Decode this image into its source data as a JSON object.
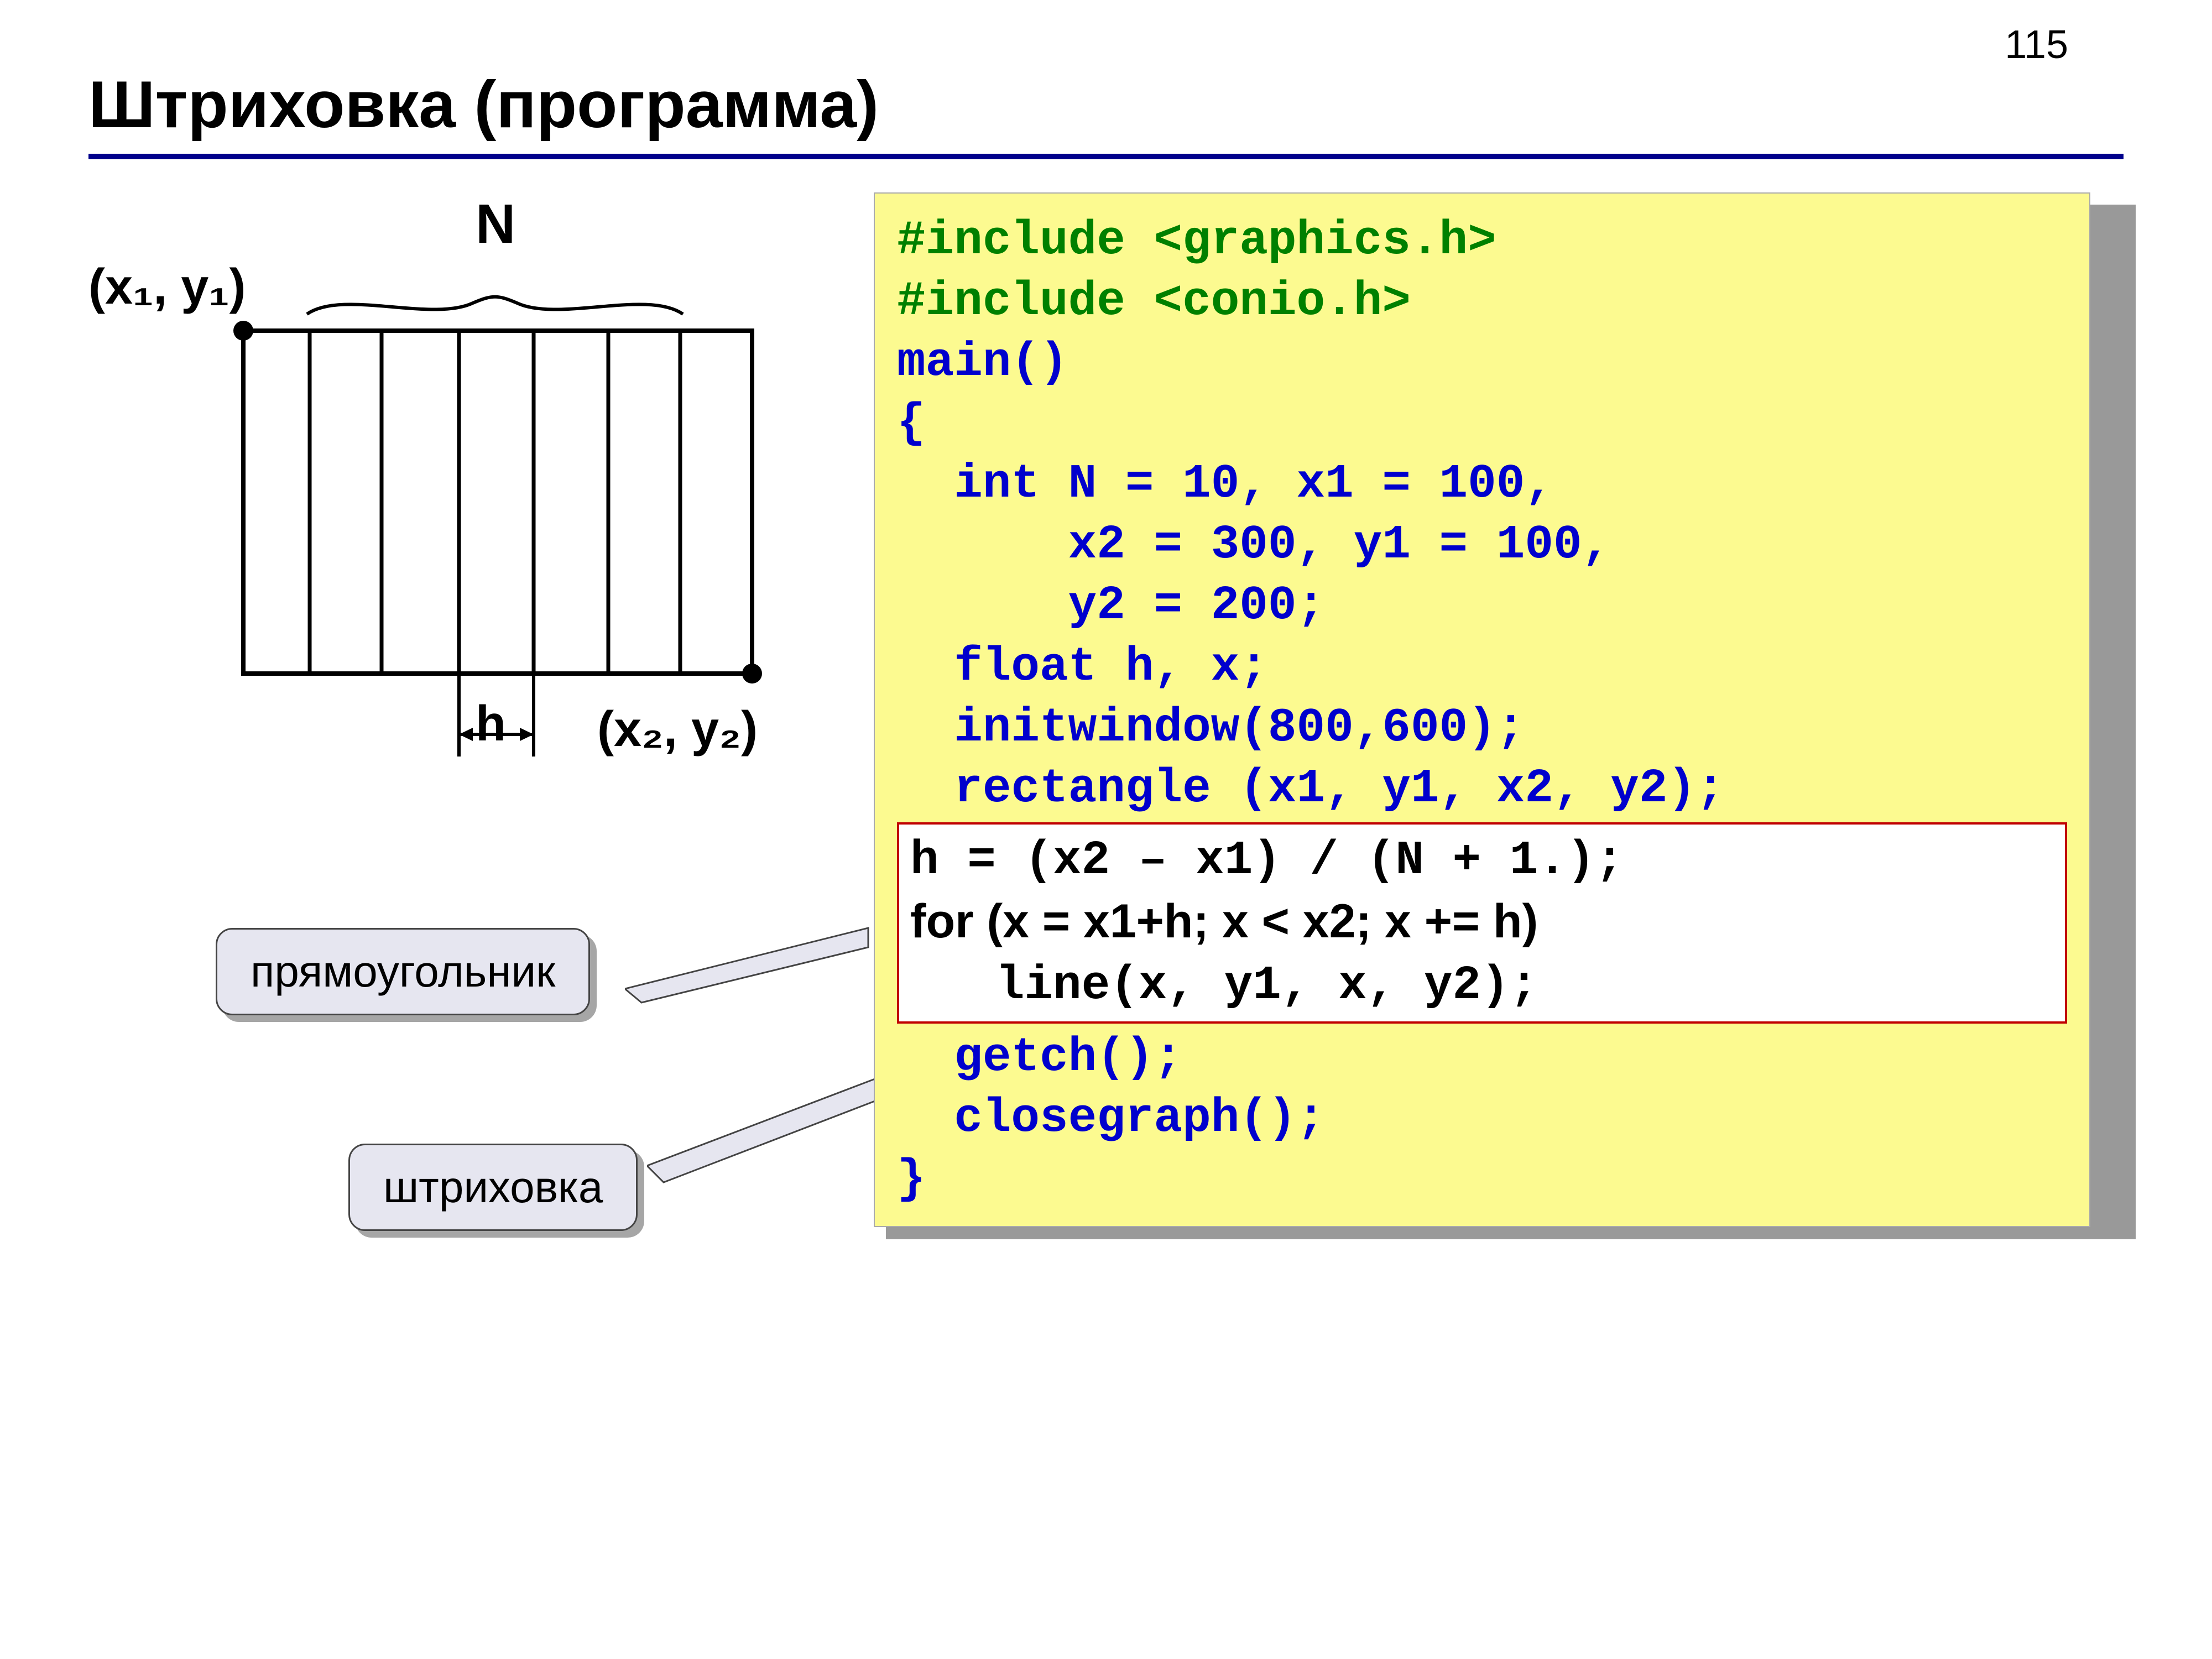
{
  "page_number": "115",
  "title": "Штриховка (программа)",
  "diagram": {
    "n_label": "N",
    "top_left": "(x₁, y₁)",
    "bot_right": "(x₂, y₂)",
    "h_label": "h"
  },
  "callouts": {
    "rectangle": "прямоугольник",
    "hatching": "штриховка"
  },
  "code": {
    "l1": "#include <graphics.h>",
    "l2": "#include <conio.h>",
    "l3": "main()",
    "l4": "{",
    "l5": "  int N = 10, x1 = 100,",
    "l6": "      x2 = 300, y1 = 100,",
    "l7": "      y2 = 200;",
    "l8": "  float h, x;",
    "l9": "  initwindow(800,600);",
    "l10": "  rectangle (x1, y1, x2, y2);",
    "l11": "h = (x2 – x1) / (N + 1.);",
    "l12a": "for",
    "l12b": " (x = x1+h; x < x2; x += h)",
    "l13": "   line(x, y1, x, y2);",
    "l14": "  getch();",
    "l15": "  closegraph();",
    "l16": "}"
  }
}
